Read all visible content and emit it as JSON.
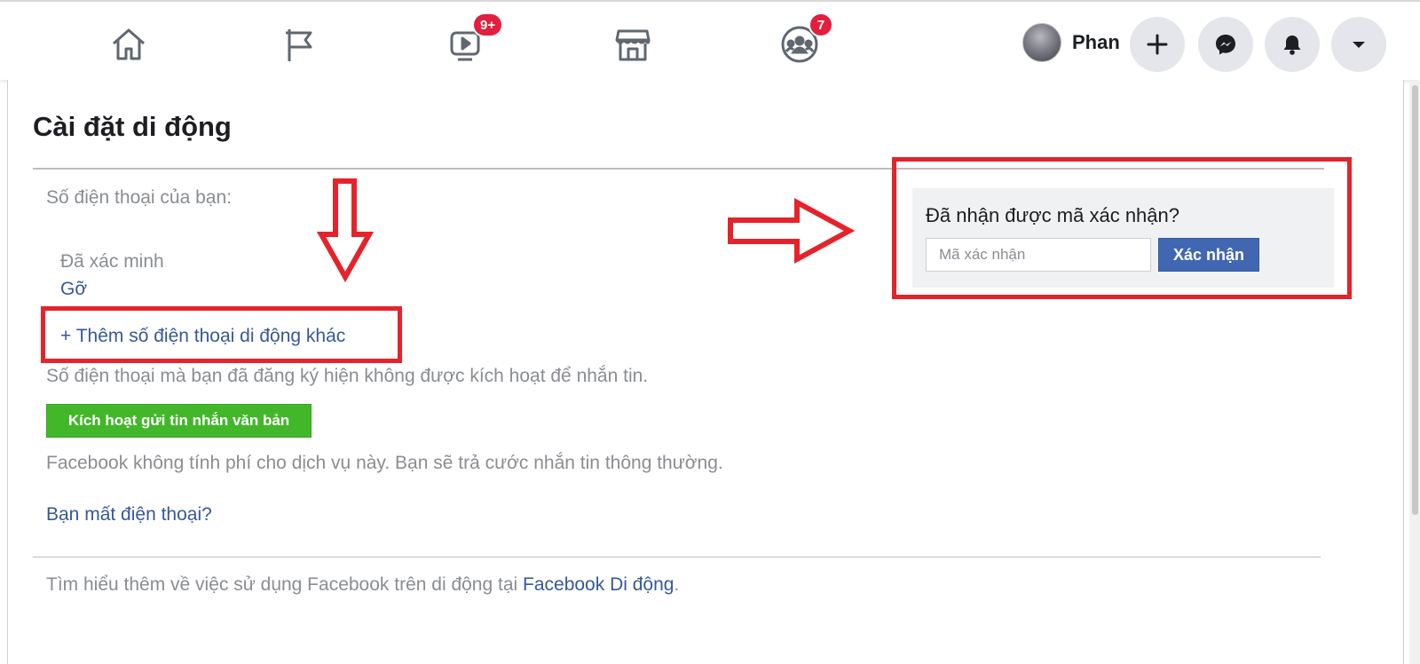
{
  "nav": {
    "watch_badge": "9+",
    "groups_badge": "7",
    "profile_name": "Phan",
    "badge_color": "#e41e3f"
  },
  "page": {
    "title": "Cài đặt di động",
    "phone_label": "Số điện thoại của bạn:",
    "verified_status": "Đã xác minh",
    "remove_link": "Gỡ",
    "add_phone_link": "+ Thêm số điện thoại di động khác",
    "sms_notice": "Số điện thoại mà bạn đã đăng ký hiện không được kích hoạt để nhắn tin.",
    "activate_sms_button": "Kích hoạt gửi tin nhắn văn bản",
    "fee_notice": "Facebook không tính phí cho dịch vụ này. Bạn sẽ trả cước nhắn tin thông thường.",
    "lost_phone_link": "Bạn mất điện thoại?",
    "footer_text": "Tìm hiểu thêm về việc sử dụng Facebook trên di động tại ",
    "footer_link": "Facebook Di động",
    "footer_period": "."
  },
  "verify": {
    "prompt": "Đã nhận được mã xác nhận?",
    "code_placeholder": "Mã xác nhận",
    "confirm_button": "Xác nhận"
  },
  "colors": {
    "link": "#365899",
    "primary_button": "#4267b2",
    "green_button": "#42b72a",
    "annotation_red": "#e5232b"
  }
}
